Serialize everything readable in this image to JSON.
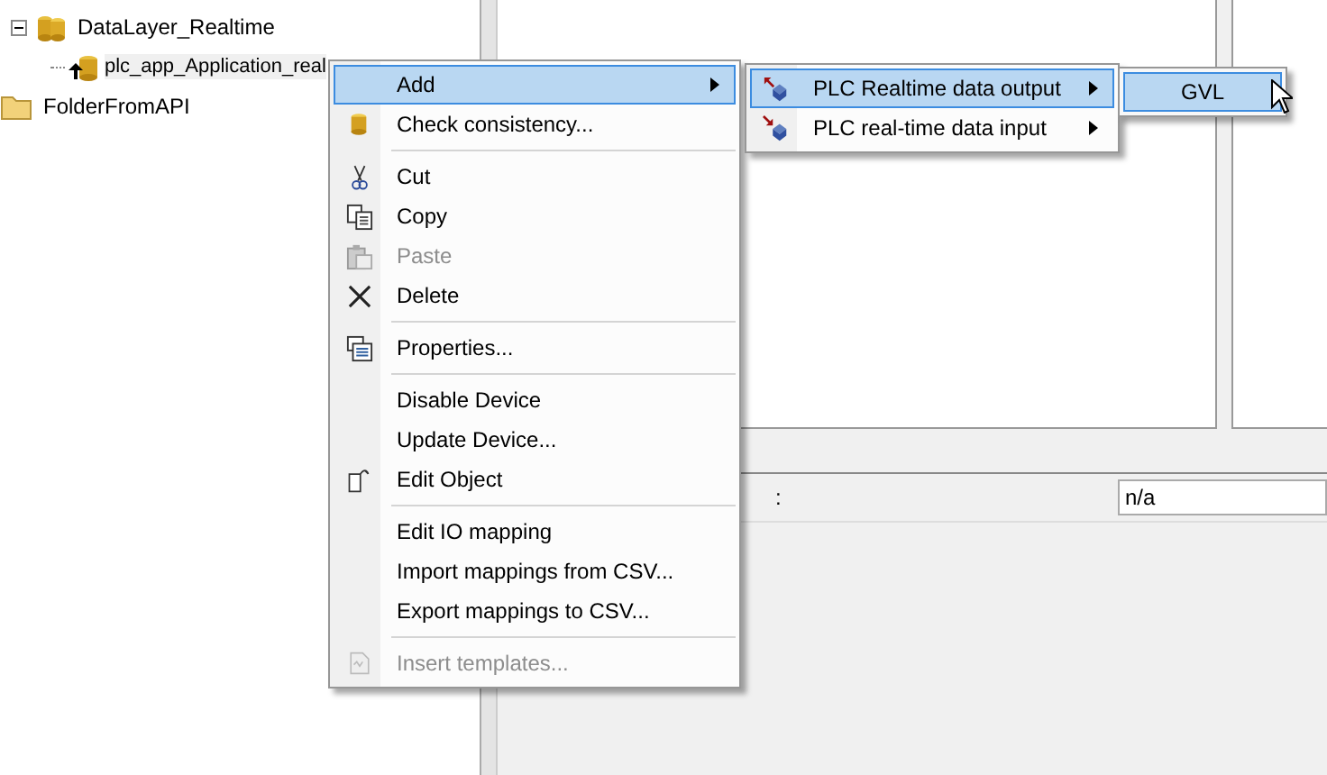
{
  "tree": [
    {
      "label": "DataLayer_Realtime",
      "expanded": true,
      "selected": false,
      "children": [
        {
          "label": "plc_app_Application_real",
          "selected": true
        }
      ]
    },
    {
      "label": "FolderFromAPI",
      "selected": false
    }
  ],
  "properties": {
    "separator": ":",
    "value": "n/a"
  },
  "context_menu": [
    {
      "kind": "item",
      "label": "Add",
      "submenu": true,
      "selected": true,
      "disabled": false
    },
    {
      "kind": "item",
      "label": "Check consistency...",
      "submenu": false,
      "selected": false,
      "disabled": false
    },
    {
      "kind": "separator"
    },
    {
      "kind": "item",
      "label": "Cut",
      "submenu": false,
      "selected": false,
      "disabled": false
    },
    {
      "kind": "item",
      "label": "Copy",
      "submenu": false,
      "selected": false,
      "disabled": false
    },
    {
      "kind": "item",
      "label": "Paste",
      "submenu": false,
      "selected": false,
      "disabled": true
    },
    {
      "kind": "item",
      "label": "Delete",
      "submenu": false,
      "selected": false,
      "disabled": false
    },
    {
      "kind": "separator"
    },
    {
      "kind": "item",
      "label": "Properties...",
      "submenu": false,
      "selected": false,
      "disabled": false
    },
    {
      "kind": "separator"
    },
    {
      "kind": "item",
      "label": "Disable Device",
      "submenu": false,
      "selected": false,
      "disabled": false
    },
    {
      "kind": "item",
      "label": "Update Device...",
      "submenu": false,
      "selected": false,
      "disabled": false
    },
    {
      "kind": "item",
      "label": "Edit Object",
      "submenu": false,
      "selected": false,
      "disabled": false
    },
    {
      "kind": "separator"
    },
    {
      "kind": "item",
      "label": "Edit IO mapping",
      "submenu": false,
      "selected": false,
      "disabled": false
    },
    {
      "kind": "item",
      "label": "Import mappings from CSV...",
      "submenu": false,
      "selected": false,
      "disabled": false
    },
    {
      "kind": "item",
      "label": "Export mappings to CSV...",
      "submenu": false,
      "selected": false,
      "disabled": false
    },
    {
      "kind": "separator"
    },
    {
      "kind": "item",
      "label": "Insert templates...",
      "submenu": false,
      "selected": false,
      "disabled": true
    }
  ],
  "add_submenu": [
    {
      "label": "PLC Realtime data output",
      "submenu": true,
      "selected": true
    },
    {
      "label": "PLC real-time data input",
      "submenu": true,
      "selected": false
    }
  ],
  "output_submenu": [
    {
      "label": "GVL",
      "selected": true
    }
  ]
}
